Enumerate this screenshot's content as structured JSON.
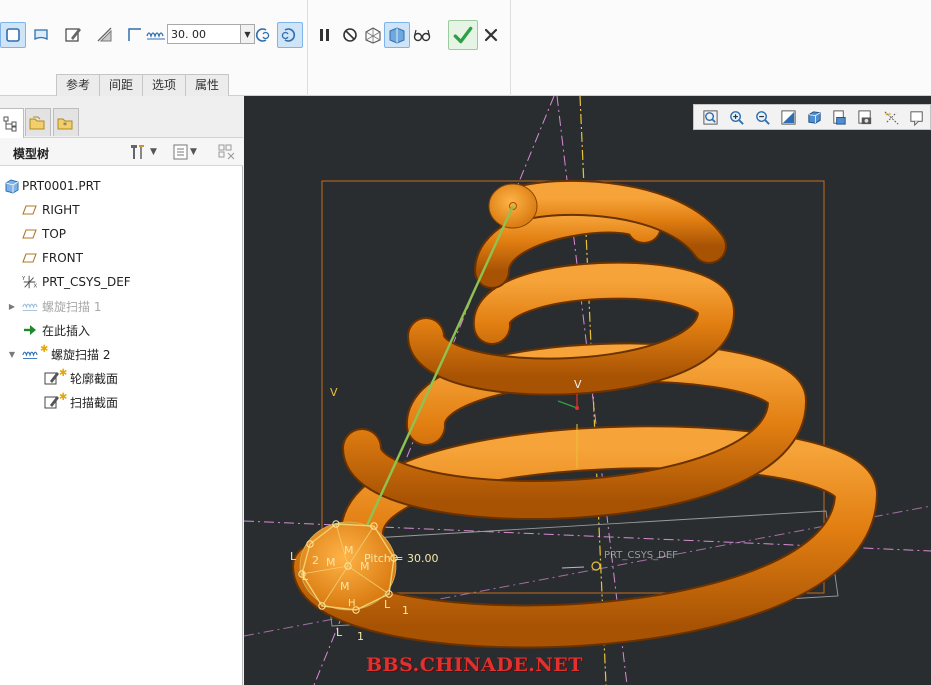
{
  "ribbon": {
    "pitch_value": "30. 00",
    "tabs": [
      "参考",
      "间距",
      "选项",
      "属性"
    ]
  },
  "model_tree": {
    "title": "模型树",
    "items": [
      {
        "label": "PRT0001.PRT",
        "icon": "part-icon",
        "expander": "",
        "dim": false,
        "star": false
      },
      {
        "label": "RIGHT",
        "icon": "datum-plane-icon",
        "expander": "",
        "dim": false,
        "star": false
      },
      {
        "label": "TOP",
        "icon": "datum-plane-icon",
        "expander": "",
        "dim": false,
        "star": false
      },
      {
        "label": "FRONT",
        "icon": "datum-plane-icon",
        "expander": "",
        "dim": false,
        "star": false
      },
      {
        "label": "PRT_CSYS_DEF",
        "icon": "csys-icon",
        "expander": "",
        "dim": false,
        "star": false
      },
      {
        "label": "螺旋扫描 1",
        "icon": "helical-sweep-icon",
        "expander": "▶",
        "dim": true,
        "star": false
      },
      {
        "label": "在此插入",
        "icon": "insert-here-arrow-icon",
        "expander": "",
        "dim": false,
        "star": false
      },
      {
        "label": "螺旋扫描 2",
        "icon": "helical-sweep-icon",
        "expander": "▼",
        "dim": false,
        "star": true
      },
      {
        "label": "轮廓截面",
        "icon": "sketch-icon",
        "expander": "",
        "dim": false,
        "star": true
      },
      {
        "label": "扫描截面",
        "icon": "sketch-icon",
        "expander": "",
        "dim": false,
        "star": true
      }
    ]
  },
  "viewport": {
    "pitch_label": "Pitch = 30.00",
    "csys_label": "PRT_CSYS_DEF",
    "axis_label": "V",
    "small_axis_label": "V",
    "dim_labels": [
      "L",
      "L",
      "2",
      "M",
      "M",
      "M",
      "M",
      "H",
      "L",
      "L",
      "1",
      "1"
    ],
    "watermark": "BBS.CHINADE.NET"
  },
  "colors": {
    "viewport_bg": "#2a2d30",
    "spring": "#e07f10",
    "axis_line": "#8fc24f",
    "selection_box": "#c26d1e",
    "watermark": "#e0312f",
    "confirm": "#2ea043"
  }
}
